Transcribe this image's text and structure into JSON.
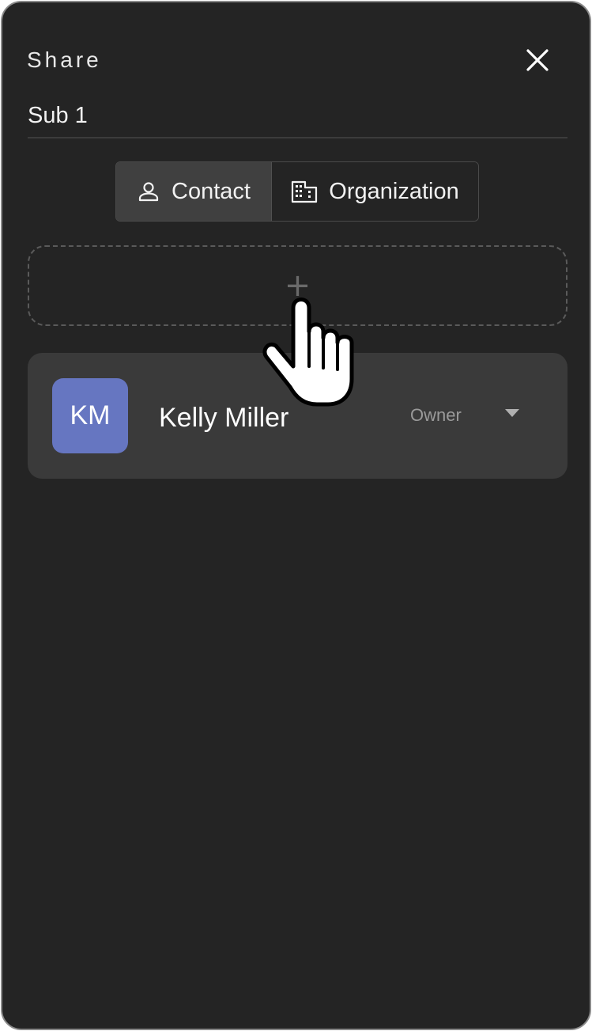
{
  "dialog": {
    "title": "Share",
    "subtitle": "Sub 1"
  },
  "tabs": [
    {
      "label": "Contact",
      "icon": "person-icon",
      "selected": true
    },
    {
      "label": "Organization",
      "icon": "building-icon",
      "selected": false
    }
  ],
  "add_zone": {
    "icon": "plus-icon",
    "glyph": "+"
  },
  "members": [
    {
      "initials": "KM",
      "name": "Kelly Miller",
      "role": "Owner",
      "avatar_color": "#6676c1"
    }
  ],
  "colors": {
    "background": "#242424",
    "card": "#3a3a3a",
    "selected_tab": "#404040"
  }
}
